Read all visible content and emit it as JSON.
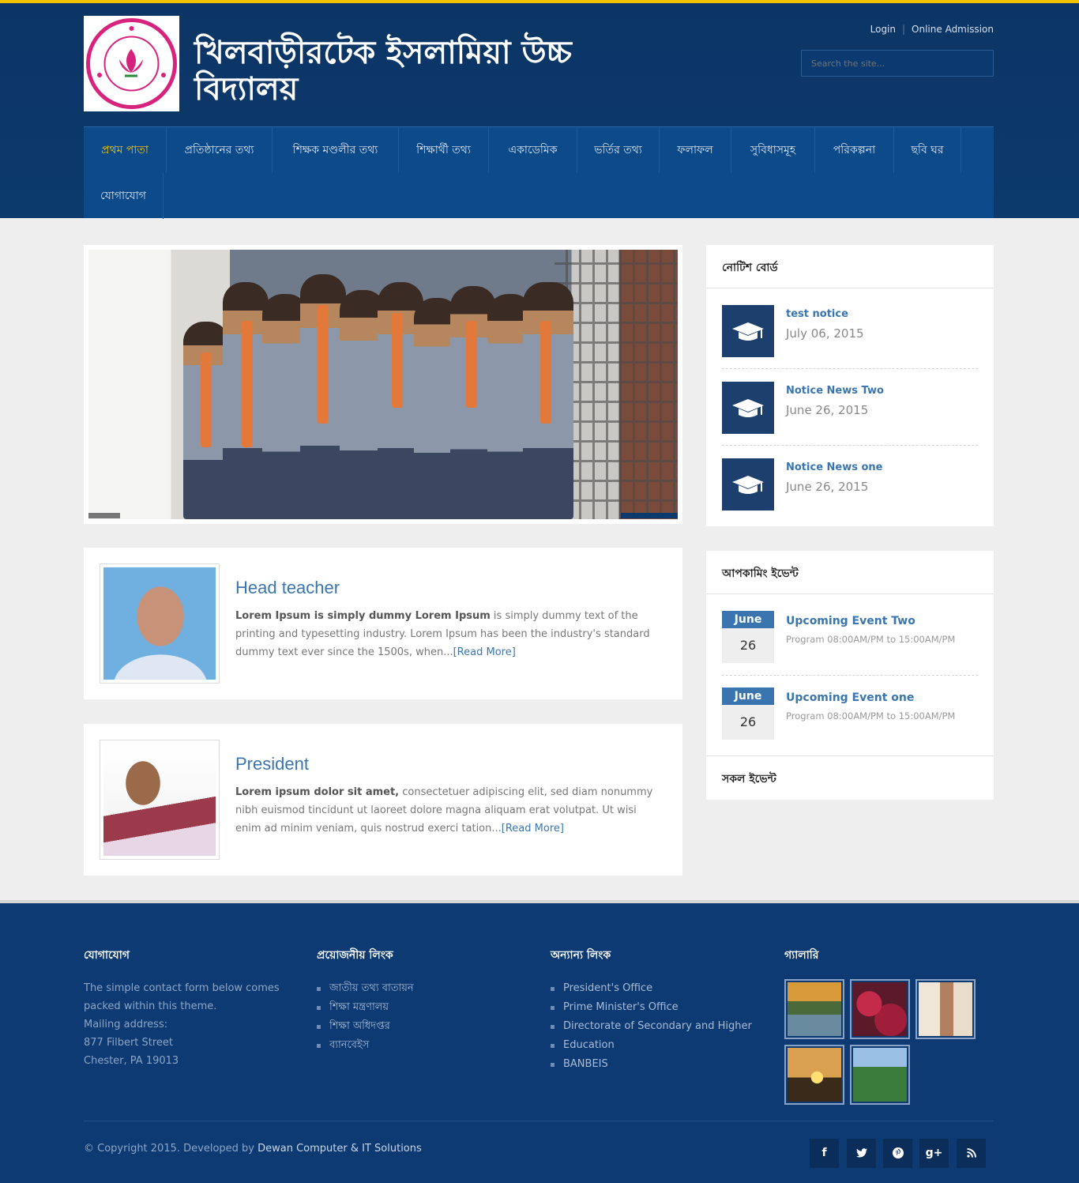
{
  "header": {
    "site_title": "খিলবাড়ীরটেক ইসলামিয়া উচ্চ বিদ্যালয়",
    "login": "Login",
    "separator": "|",
    "admission": "Online Admission",
    "search_placeholder": "Search the site..."
  },
  "nav": {
    "items": [
      {
        "label": "প্রথম পাতা",
        "active": true
      },
      {
        "label": "প্রতিষ্ঠানের তথ্য"
      },
      {
        "label": "শিক্ষক মণ্ডলীর তথ্য"
      },
      {
        "label": "শিক্ষার্থী তথ্য"
      },
      {
        "label": "একাডেমিক"
      },
      {
        "label": "ভর্তির তথ্য"
      },
      {
        "label": "ফলাফল"
      },
      {
        "label": "সুবিধাসমূহ"
      },
      {
        "label": "পরিকল্পনা"
      },
      {
        "label": "ছবি ঘর"
      },
      {
        "label": "যোগাযোগ"
      }
    ]
  },
  "profiles": [
    {
      "title": "Head teacher",
      "bold": "Lorem Ipsum is simply dummy Lorem Ipsum",
      "text": " is simply dummy text of the printing and typesetting industry. Lorem Ipsum has been the industry's standard dummy text ever since the 1500s, when...",
      "more": "[Read More]"
    },
    {
      "title": "President",
      "bold": "Lorem ipsum dolor sit amet,",
      "text": " consectetuer adipiscing elit, sed diam nonummy nibh euismod tincidunt ut laoreet dolore magna aliquam erat volutpat. Ut wisi enim ad minim veniam, quis nostrud exerci tation...",
      "more": "[Read More]"
    }
  ],
  "notice_board": {
    "title": "নোটিশ বোর্ড",
    "items": [
      {
        "title": "test notice",
        "date": "July 06, 2015"
      },
      {
        "title": "Notice News Two",
        "date": "June 26, 2015"
      },
      {
        "title": "Notice News one",
        "date": "June 26, 2015"
      }
    ]
  },
  "events": {
    "title": "আপকামিং ইভেন্ট",
    "all_label": "সকল ইভেন্ট",
    "items": [
      {
        "month": "June",
        "day": "26",
        "title": "Upcoming Event Two",
        "time": "Program 08:00AM/PM to 15:00AM/PM"
      },
      {
        "month": "June",
        "day": "26",
        "title": "Upcoming Event one",
        "time": "Program 08:00AM/PM to 15:00AM/PM"
      }
    ]
  },
  "footer": {
    "contact": {
      "title": "যোগাযোগ",
      "lines": [
        "The simple contact form below comes",
        "packed within this theme.",
        "Mailing address:",
        "877 Filbert Street",
        "Chester, PA 19013"
      ]
    },
    "useful_links": {
      "title": "প্রয়োজনীয় লিংক",
      "items": [
        "জাতীয় তথ্য বাতায়ন",
        "শিক্ষা মন্ত্রণালয়",
        "শিক্ষা অধিদপ্তর",
        "ব্যানবেইস"
      ]
    },
    "other_links": {
      "title": "অন্যান্য লিংক",
      "items": [
        "President's Office",
        "Prime Minister's Office",
        "Directorate of Secondary and Higher",
        "Education",
        "BANBEIS"
      ]
    },
    "gallery": {
      "title": "গ্যালারি"
    },
    "copyright": "© Copyright 2015. Developed by ",
    "developer": "Dewan Computer & IT Solutions",
    "social": [
      "f",
      "t",
      "p",
      "g+",
      "rss"
    ]
  },
  "colors": {
    "brand": "#0c3a6c",
    "accent": "#f6c700",
    "link": "#3a75b0"
  }
}
